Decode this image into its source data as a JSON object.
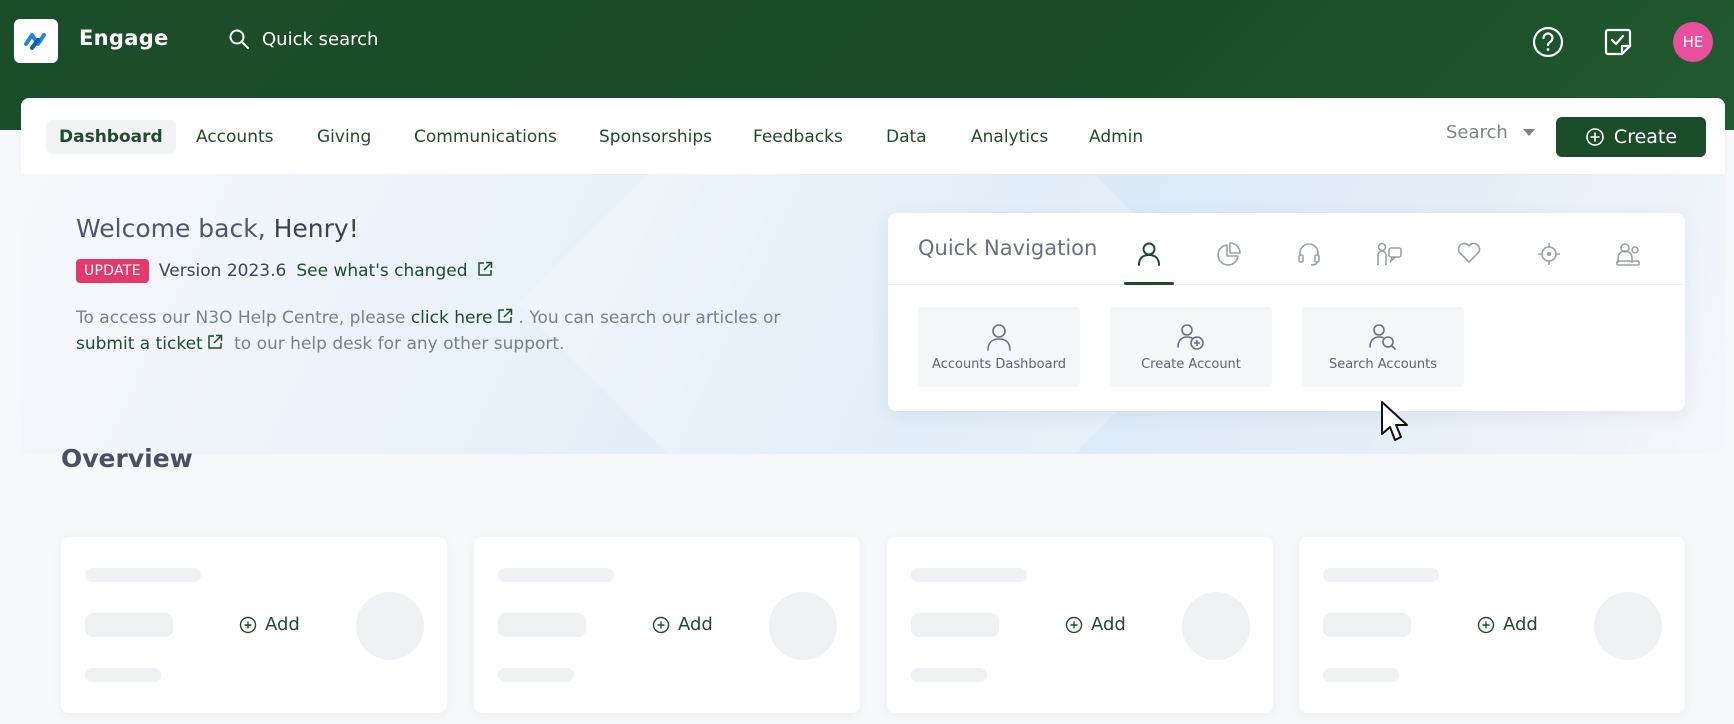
{
  "app": {
    "name": "Engage",
    "logo": "n3o-logo"
  },
  "topbar": {
    "search_placeholder": "Quick search",
    "icons": [
      "help-icon",
      "tasks-icon"
    ],
    "avatar_initials": "HE",
    "avatar_color": "#e8509b"
  },
  "nav": {
    "items": [
      {
        "label": "Dashboard"
      },
      {
        "label": "Accounts"
      },
      {
        "label": "Giving"
      },
      {
        "label": "Communications"
      },
      {
        "label": "Sponsorships"
      },
      {
        "label": "Feedbacks"
      },
      {
        "label": "Data"
      },
      {
        "label": "Analytics"
      },
      {
        "label": "Admin"
      }
    ],
    "active": "Dashboard",
    "search_label": "Search",
    "create_label": "Create"
  },
  "welcome": {
    "greeting": "Welcome back,",
    "name": "Henry!",
    "badge": "UPDATE",
    "version": "Version 2023.6",
    "changes_link": "See what's changed",
    "help_prefix": "To access our N3O Help Centre, please",
    "help_link": "click here",
    "help_middle": ". You can search our articles or",
    "ticket_link_part1": "submit a",
    "ticket_link_part2": "ticket",
    "help_suffix": "to our help desk for any other support."
  },
  "quick_nav": {
    "title": "Quick Navigation",
    "tabs": [
      "user-icon",
      "pie-chart-icon",
      "headset-icon",
      "person-chat-icon",
      "heart-icon",
      "crosshair-icon",
      "group-icon"
    ],
    "active_tab": "user-icon",
    "tiles": [
      {
        "label": "Accounts Dashboard",
        "icon": "user-icon"
      },
      {
        "label": "Create Account",
        "icon": "user-plus-icon"
      },
      {
        "label": "Search Accounts",
        "icon": "user-search-icon"
      }
    ]
  },
  "overview": {
    "title": "Overview",
    "cards": [
      {
        "add_label": "Add"
      },
      {
        "add_label": "Add"
      },
      {
        "add_label": "Add"
      },
      {
        "add_label": "Add"
      }
    ]
  },
  "colors": {
    "brand": "#1c4d2a",
    "badge": "#e23a6b"
  }
}
